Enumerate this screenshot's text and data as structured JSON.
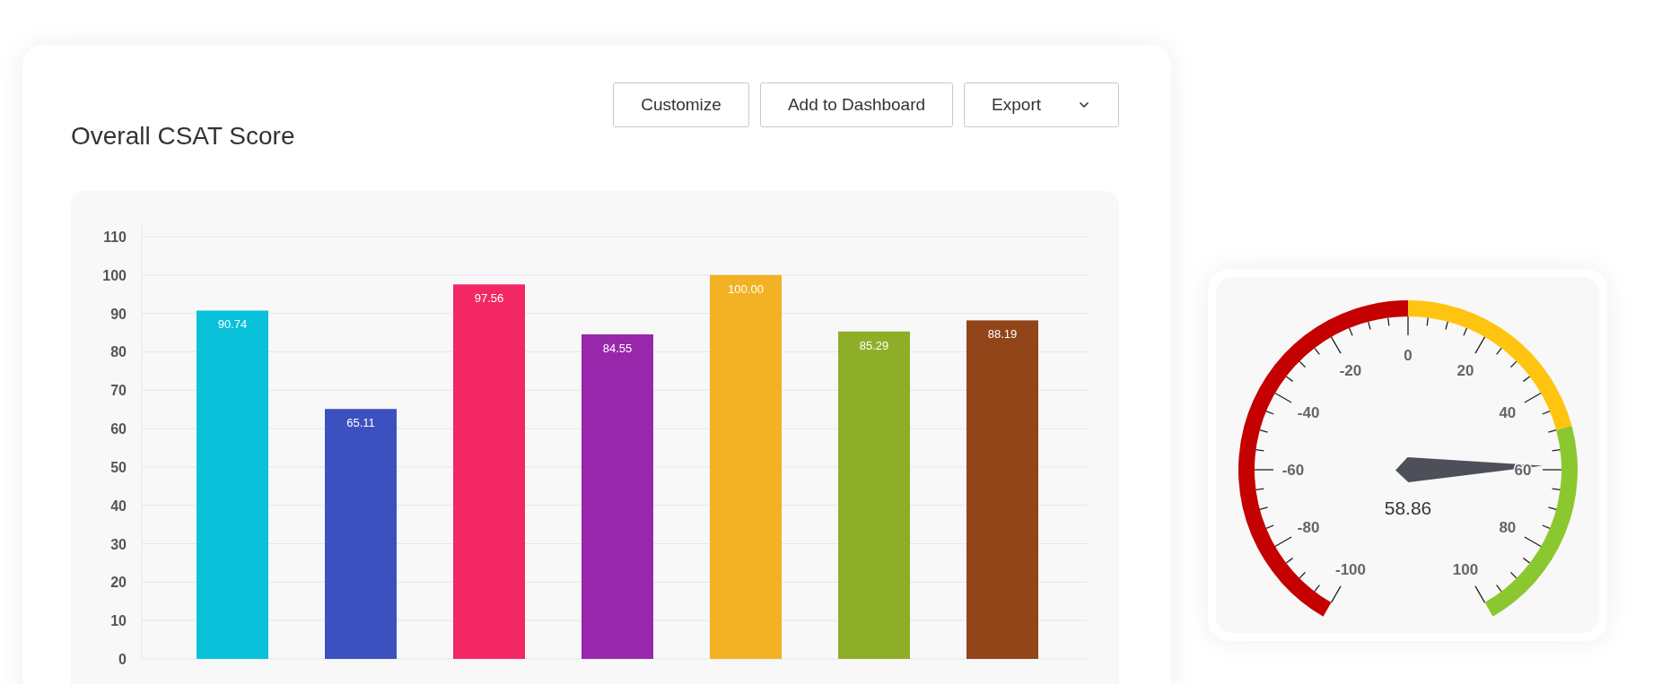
{
  "report": {
    "title": "Overall CSAT Score",
    "buttons": [
      {
        "label": "Customize",
        "kind": "plain"
      },
      {
        "label": "Add to Dashboard",
        "kind": "plain"
      },
      {
        "label": "Export",
        "kind": "dropdown"
      }
    ],
    "chart_data": {
      "type": "bar",
      "values": [
        90.74,
        65.11,
        97.56,
        84.55,
        100.0,
        85.29,
        88.19
      ],
      "colors": [
        "#09c1d9",
        "#3c50bf",
        "#f22763",
        "#9927ac",
        "#f2b224",
        "#8fae27",
        "#914519"
      ],
      "value_labels": [
        "90.74",
        "65.11",
        "97.56",
        "84.55",
        "100.00",
        "85.29",
        "88.19"
      ],
      "ylim": [
        0,
        110
      ],
      "yticks": [
        0,
        10,
        20,
        30,
        40,
        50,
        60,
        70,
        80,
        90,
        100,
        110
      ],
      "grid": true
    }
  },
  "gauge": {
    "value": "58.86",
    "level": 0.7943,
    "ticks": [
      "-100",
      "-80",
      "-60",
      "-40",
      "-20",
      "0",
      "20",
      "40",
      "60",
      "80",
      "100"
    ],
    "bands": [
      {
        "color": "#c40000"
      },
      {
        "color": "#fec410"
      },
      {
        "color": "#8bc830"
      }
    ]
  }
}
